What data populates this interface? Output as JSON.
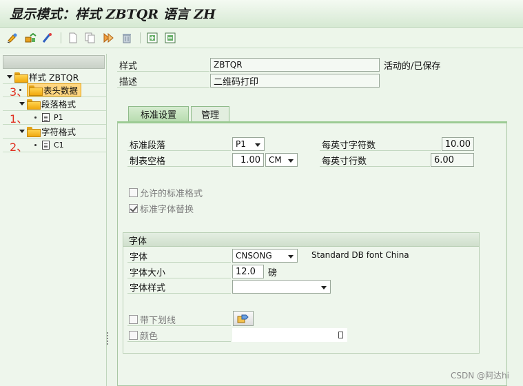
{
  "window": {
    "title": "显示模式：样式 ZBTQR 语言 ZH"
  },
  "toolbar": {
    "buttons": [
      "display-change-icon",
      "other-object-icon",
      "activate-icon",
      "new-icon",
      "copy-icon",
      "execute-icon",
      "delete-icon",
      "expand-icon",
      "collapse-icon"
    ]
  },
  "tree": {
    "root": "样式 ZBTQR",
    "header_data": "表头数据",
    "paragraph_formats": "段落格式",
    "p1": "P1",
    "character_formats": "字符格式",
    "c1": "C1",
    "annotations": {
      "header": "3、",
      "p1": "1、",
      "c1": "2、"
    }
  },
  "header": {
    "style_label": "样式",
    "style_value": "ZBTQR",
    "status": "活动的/已保存",
    "desc_label": "描述",
    "desc_value": "二维码打印"
  },
  "tabs": [
    {
      "label": "标准设置",
      "active": true
    },
    {
      "label": "管理",
      "active": false
    }
  ],
  "standard_settings": {
    "std_paragraph_label": "标准段落",
    "std_paragraph_value": "P1",
    "tab_spacing_label": "制表空格",
    "tab_spacing_value": "1.00",
    "tab_spacing_unit": "CM",
    "cpi_label": "每英寸字符数",
    "cpi_value": "10.00",
    "lpi_label": "每英寸行数",
    "lpi_value": "6.00",
    "allowed_std_formats_label": "允许的标准格式",
    "allowed_std_formats_checked": false,
    "std_font_replace_label": "标准字体替换",
    "std_font_replace_checked": true
  },
  "font_group": {
    "title": "字体",
    "family_label": "字体",
    "family_value": "CNSONG",
    "family_desc": "Standard DB font China",
    "size_label": "字体大小",
    "size_value": "12.0",
    "size_unit": "磅",
    "style_label": "字体样式",
    "style_value": "",
    "underline_label": "带下划线",
    "underline_checked": false,
    "color_label": "颜色",
    "color_checked": false,
    "color_value": ""
  },
  "watermark": "CSDN @阿达hi"
}
